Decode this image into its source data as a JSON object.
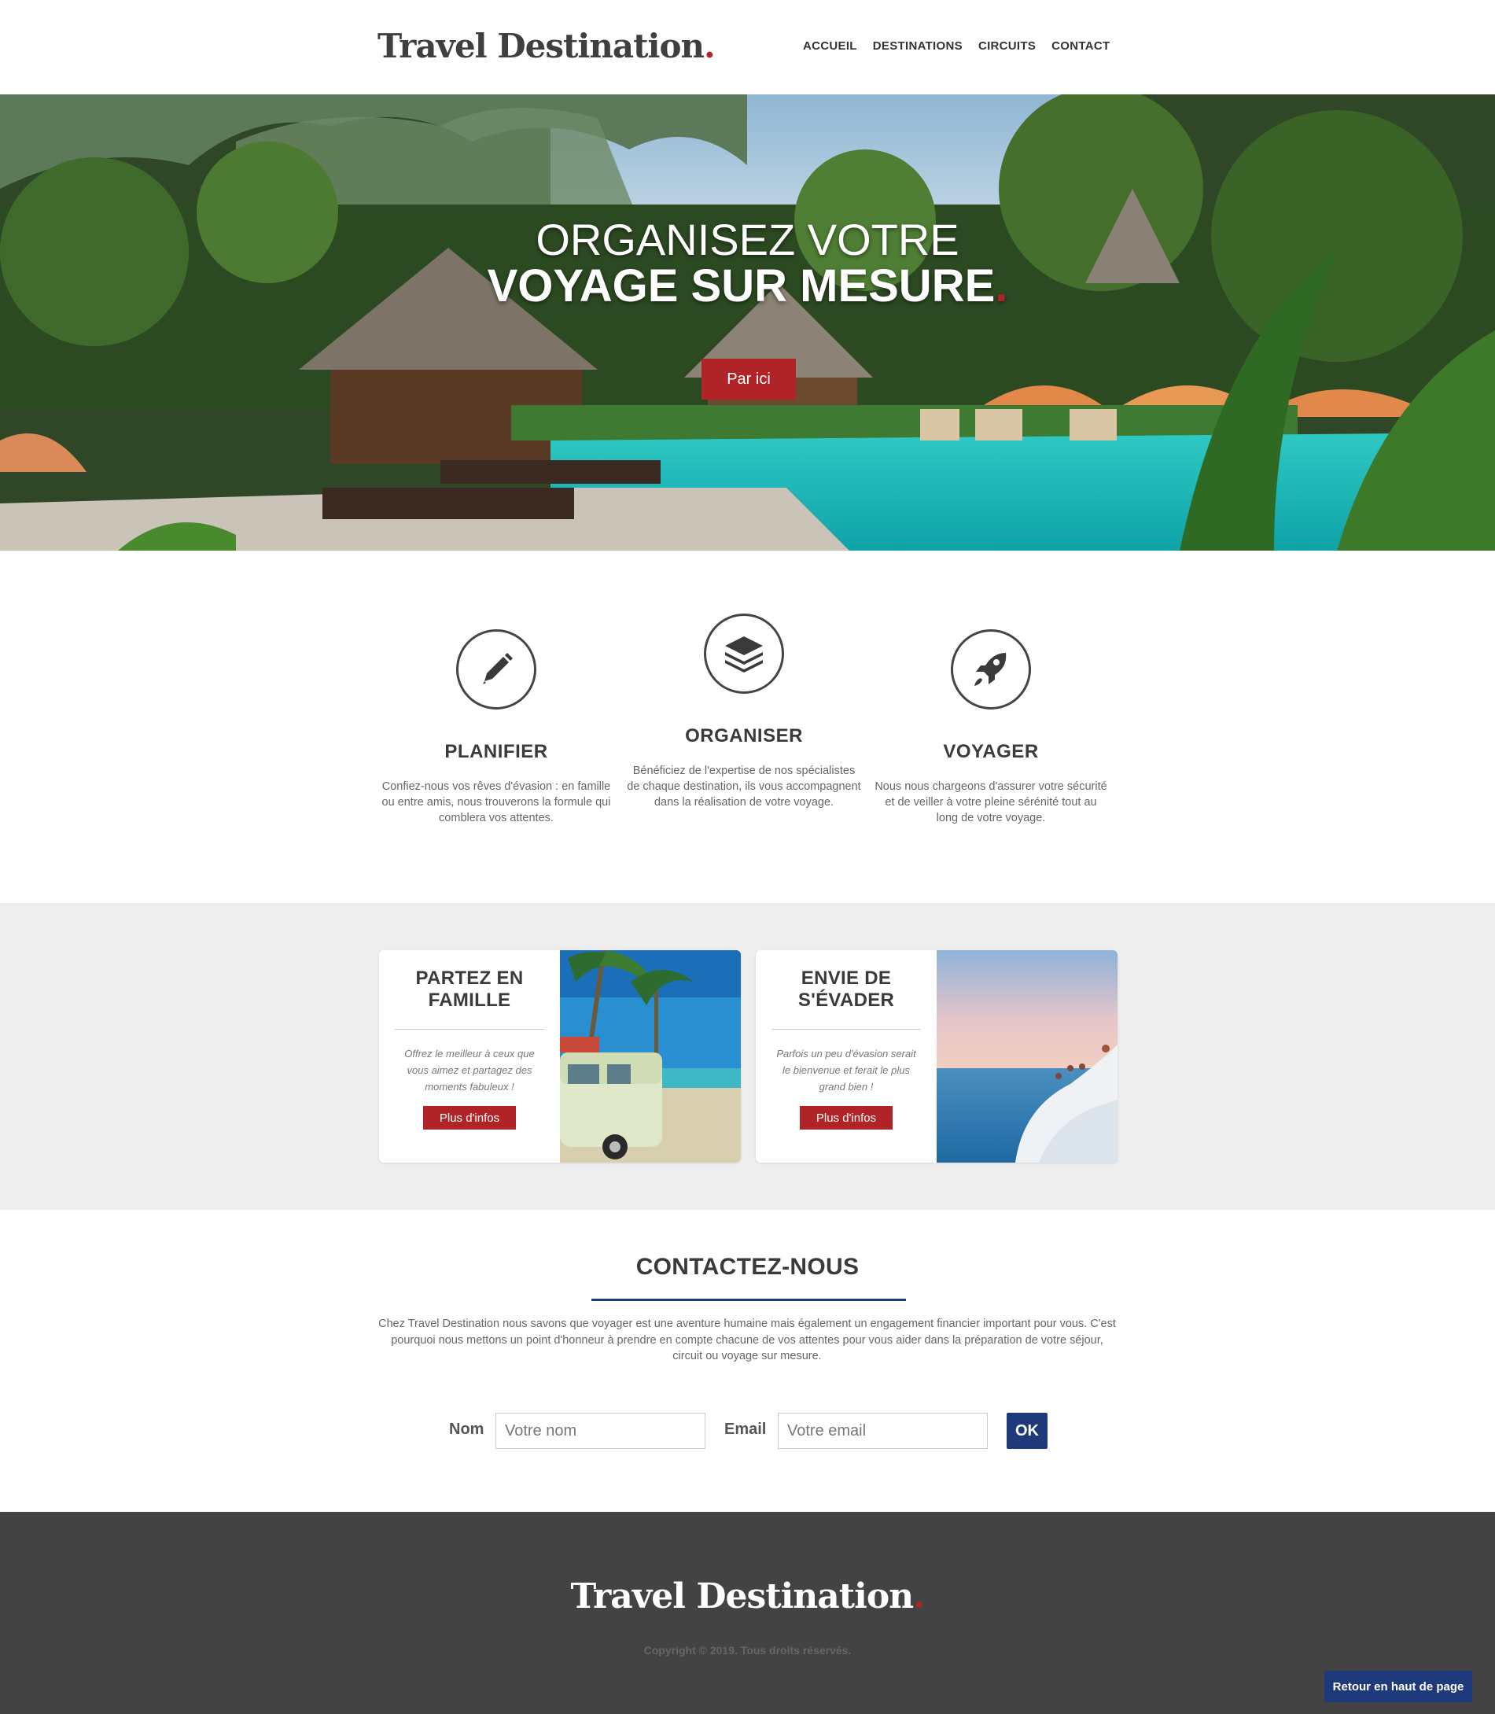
{
  "header": {
    "logo_text": "Travel Destination",
    "logo_dot": ".",
    "nav": [
      "ACCUEIL",
      "DESTINATIONS",
      "CIRCUITS",
      "CONTACT"
    ]
  },
  "hero": {
    "title_line1": "ORGANISEZ VOTRE",
    "title_line2": "VOYAGE SUR MESURE",
    "title_dot": ".",
    "button": "Par ici"
  },
  "features": [
    {
      "icon": "pencil-icon",
      "title": "PLANIFIER",
      "text": "Confiez-nous vos rêves d'évasion : en famille ou entre amis, nous trouverons la formule qui comblera vos attentes."
    },
    {
      "icon": "layers-icon",
      "title": "ORGANISER",
      "text": "Bénéficiez de l'expertise de nos spécialistes de chaque destination, ils vous accompagnent dans la réalisation de votre voyage."
    },
    {
      "icon": "rocket-icon",
      "title": "VOYAGER",
      "text": "Nous nous chargeons d'assurer votre sécurité et de veiller à votre pleine sérénité tout au long de votre voyage."
    }
  ],
  "cards": [
    {
      "title": "PARTEZ EN FAMILLE",
      "text": "Offrez le meilleur à ceux que vous aimez et partagez des moments fabuleux !",
      "button": "Plus d'infos"
    },
    {
      "title": "ENVIE DE S'ÉVADER",
      "text": "Parfois un peu d'évasion serait le bienvenue et ferait le plus grand bien !",
      "button": "Plus d'infos"
    }
  ],
  "contact": {
    "title": "CONTACTEZ-NOUS",
    "text": "Chez Travel Destination nous savons que voyager est une aventure humaine mais également un engagement financier important pour vous. C'est pourquoi nous mettons un point d'honneur à prendre en compte chacune de vos attentes pour vous aider dans la préparation de votre séjour, circuit ou voyage sur mesure.",
    "name_label": "Nom",
    "name_placeholder": "Votre nom",
    "email_label": "Email",
    "email_placeholder": "Votre email",
    "submit": "OK"
  },
  "footer": {
    "logo_text": "Travel Destination",
    "logo_dot": ".",
    "copyright": "Copyright © 2019. Tous droits réservés.",
    "back_to_top": "Retour en haut de page"
  },
  "colors": {
    "accent_red": "#b02428",
    "accent_blue": "#1e3a7a",
    "footer_bg": "#434343",
    "section_bg": "#eeeeee"
  }
}
